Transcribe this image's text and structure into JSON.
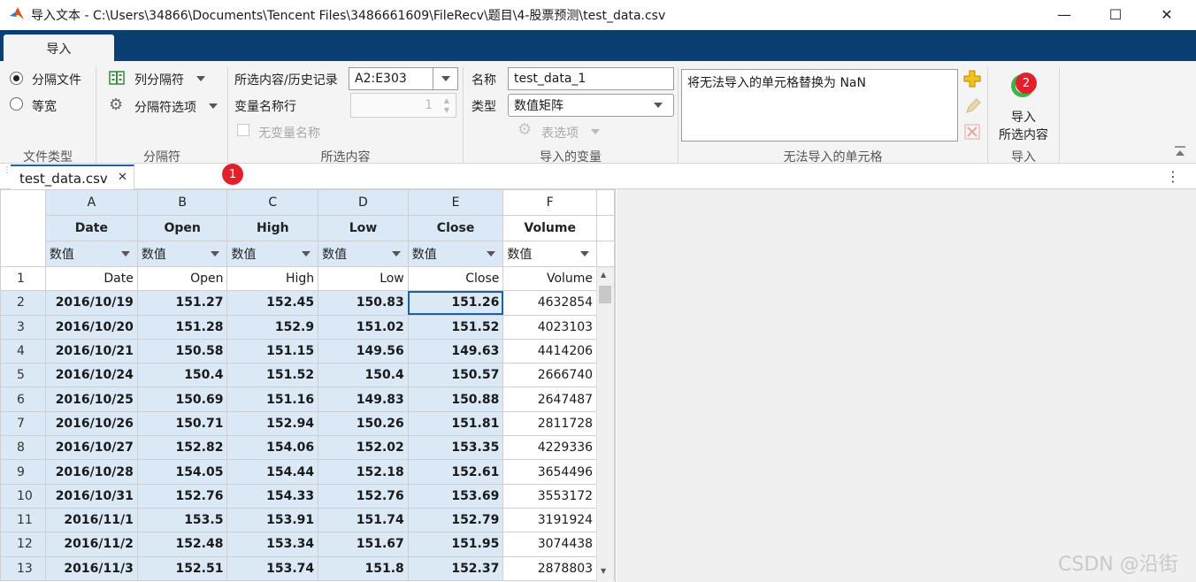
{
  "window": {
    "title": "导入文本 - C:\\Users\\34866\\Documents\\Tencent Files\\3486661609\\FileRecv\\题目\\4-股票预测\\test_data.csv",
    "minimize": "—",
    "maximize": "☐",
    "close": "✕"
  },
  "ribbon_tab": "导入",
  "file_type": {
    "delimited": "分隔文件",
    "fixed_width": "等宽",
    "group_label": "文件类型"
  },
  "delimiters": {
    "column_delimiter": "列分隔符",
    "delimiter_options": "分隔符选项",
    "group_label": "分隔符"
  },
  "selection": {
    "range_label": "所选内容/历史记录",
    "range_value": "A2:E303",
    "var_names_row_label": "变量名称行",
    "var_names_row_value": "1",
    "no_var_names": "无变量名称",
    "group_label": "所选内容"
  },
  "imported_vars": {
    "name_label": "名称",
    "name_value": "test_data_1",
    "type_label": "类型",
    "type_value": "数值矩阵",
    "table_options": "表选项",
    "group_label": "导入的变量"
  },
  "unimportable": {
    "rule": "将无法导入的单元格替换为 NaN",
    "group_label": "无法导入的单元格"
  },
  "import": {
    "button_line1": "导入",
    "button_line2": "所选内容",
    "group_label": "导入"
  },
  "badges": {
    "one": "1",
    "two": "2"
  },
  "doc_tab": {
    "label": "test_data.csv",
    "close": "✕"
  },
  "kebab": "⋮",
  "grid": {
    "columns": [
      {
        "letter": "A",
        "name": "Date",
        "type": "数值"
      },
      {
        "letter": "B",
        "name": "Open",
        "type": "数值"
      },
      {
        "letter": "C",
        "name": "High",
        "type": "数值"
      },
      {
        "letter": "D",
        "name": "Low",
        "type": "数值"
      },
      {
        "letter": "E",
        "name": "Close",
        "type": "数值"
      },
      {
        "letter": "F",
        "name": "Volume",
        "type": "数值"
      }
    ],
    "rows": [
      {
        "n": "1",
        "cells": [
          "Date",
          "Open",
          "High",
          "Low",
          "Close",
          "Volume"
        ]
      },
      {
        "n": "2",
        "cells": [
          "2016/10/19",
          "151.27",
          "152.45",
          "150.83",
          "151.26",
          "4632854"
        ]
      },
      {
        "n": "3",
        "cells": [
          "2016/10/20",
          "151.28",
          "152.9",
          "151.02",
          "151.52",
          "4023103"
        ]
      },
      {
        "n": "4",
        "cells": [
          "2016/10/21",
          "150.58",
          "151.15",
          "149.56",
          "149.63",
          "4414206"
        ]
      },
      {
        "n": "5",
        "cells": [
          "2016/10/24",
          "150.4",
          "151.52",
          "150.4",
          "150.57",
          "2666740"
        ]
      },
      {
        "n": "6",
        "cells": [
          "2016/10/25",
          "150.69",
          "151.16",
          "149.83",
          "150.88",
          "2647487"
        ]
      },
      {
        "n": "7",
        "cells": [
          "2016/10/26",
          "150.71",
          "152.94",
          "150.26",
          "151.81",
          "2811728"
        ]
      },
      {
        "n": "8",
        "cells": [
          "2016/10/27",
          "152.82",
          "154.06",
          "152.02",
          "153.35",
          "4229336"
        ]
      },
      {
        "n": "9",
        "cells": [
          "2016/10/28",
          "154.05",
          "154.44",
          "152.18",
          "152.61",
          "3654496"
        ]
      },
      {
        "n": "10",
        "cells": [
          "2016/10/31",
          "152.76",
          "154.33",
          "152.76",
          "153.69",
          "3553172"
        ]
      },
      {
        "n": "11",
        "cells": [
          "2016/11/1",
          "153.5",
          "153.91",
          "151.74",
          "152.79",
          "3191924"
        ]
      },
      {
        "n": "12",
        "cells": [
          "2016/11/2",
          "152.48",
          "153.34",
          "151.67",
          "151.95",
          "3074438"
        ]
      },
      {
        "n": "13",
        "cells": [
          "2016/11/3",
          "152.51",
          "153.74",
          "151.8",
          "152.37",
          "2878803"
        ]
      }
    ]
  },
  "watermark": "CSDN @沿街",
  "colors": {
    "ribbon_blue": "#0b3f74",
    "selection_fill": "#dbe8f6",
    "badge_red": "#e0202a"
  }
}
